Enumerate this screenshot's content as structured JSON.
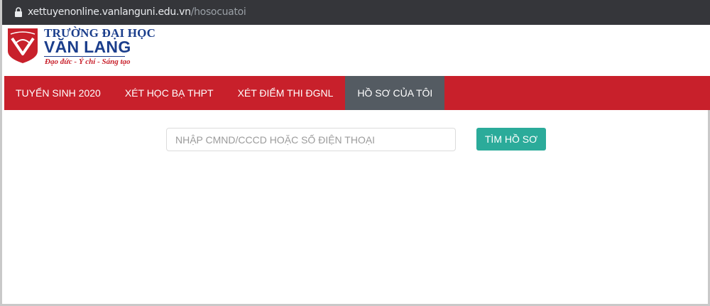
{
  "browser": {
    "url_host": "xettuyenonline.vanlanguni.edu.vn",
    "url_path": "/hosocuatoi",
    "lock_icon": "lock-icon"
  },
  "logo": {
    "line1": "TRƯỜNG ĐẠI HỌC",
    "line2": "VĂN LANG",
    "motto": "Đạo đức - Ý chí - Sáng tạo",
    "shield_icon": "shield-logo-icon",
    "brand_red": "#c8202b",
    "brand_blue": "#1b3e8c"
  },
  "nav": {
    "items": [
      {
        "label": "TUYỂN SINH 2020",
        "active": false
      },
      {
        "label": "XÉT HỌC BẠ THPT",
        "active": false
      },
      {
        "label": "XÉT ĐIỂM THI ĐGNL",
        "active": false
      },
      {
        "label": "HỒ SƠ CỦA TÔI",
        "active": true
      }
    ],
    "bar_color": "#c8202b",
    "active_color": "#545b62"
  },
  "search": {
    "placeholder": "NHẬP CMND/CCCD HOẶC SỐ ĐIỆN THOẠI",
    "value": "",
    "button_label": "TÌM HỒ SƠ",
    "button_color": "#2bab9a"
  }
}
